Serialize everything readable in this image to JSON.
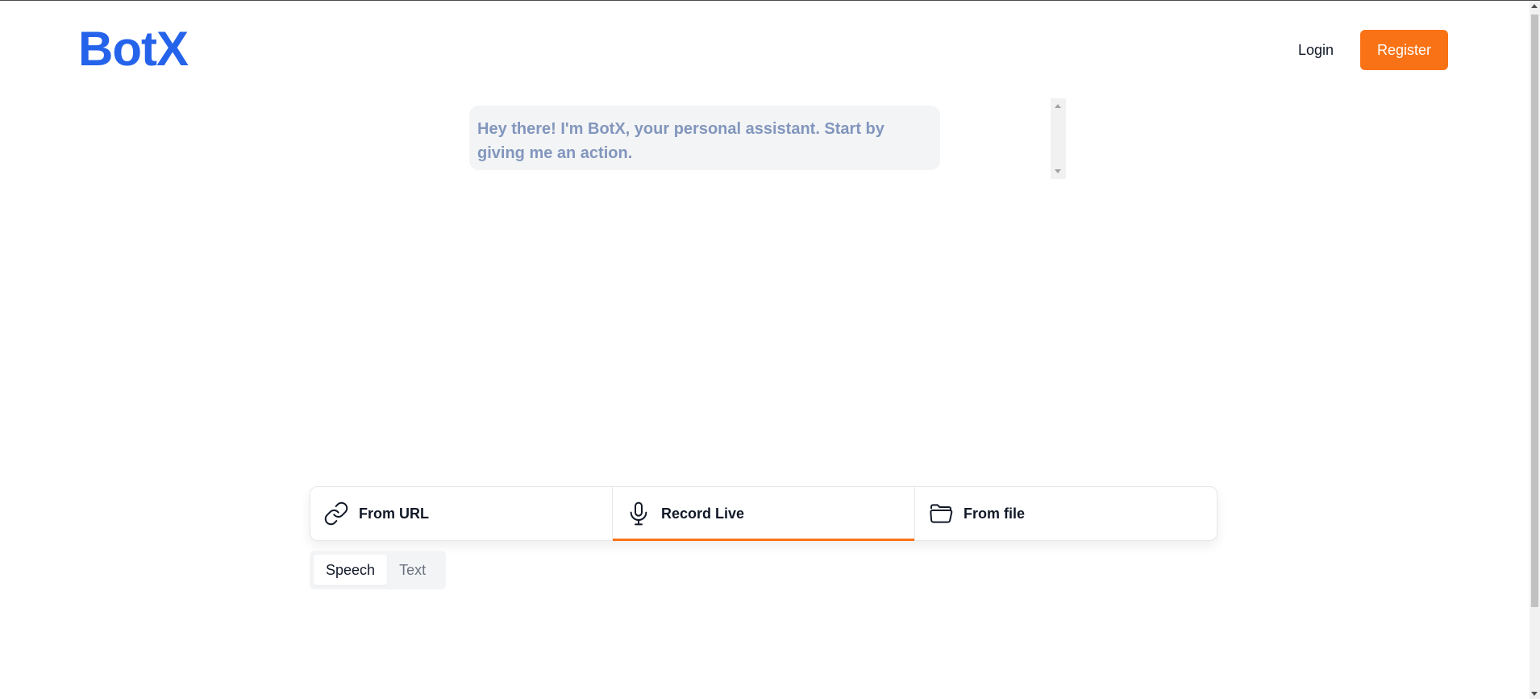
{
  "header": {
    "logo": "BotX",
    "login_label": "Login",
    "register_label": "Register",
    "accent_color": "#f97316",
    "brand_color": "#2563eb"
  },
  "chat": {
    "messages": [
      {
        "role": "bot",
        "text": "Hey there! I'm BotX, your personal assistant. Start by giving me an action."
      }
    ]
  },
  "source_tabs": [
    {
      "label": "From URL",
      "icon": "link-icon",
      "active": false
    },
    {
      "label": "Record Live",
      "icon": "microphone-icon",
      "active": true
    },
    {
      "label": "From file",
      "icon": "folder-icon",
      "active": false
    }
  ],
  "mode_toggle": {
    "options": [
      "Speech",
      "Text"
    ],
    "selected": "Speech"
  }
}
